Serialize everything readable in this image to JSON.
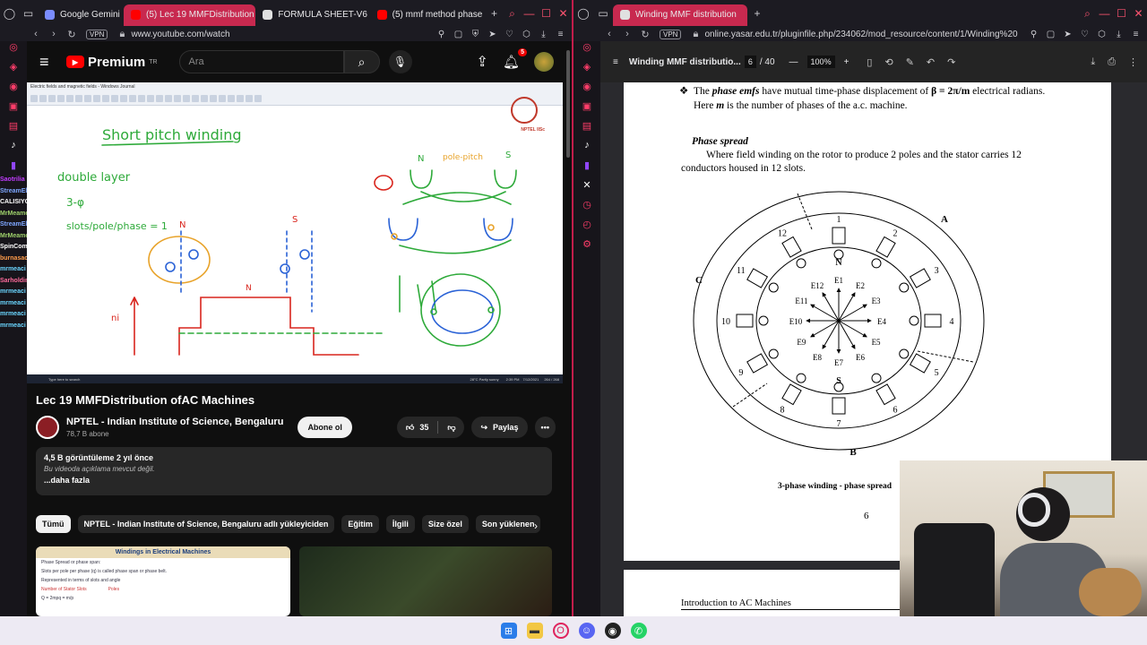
{
  "left_browser": {
    "tabs": [
      {
        "label": "Google Gemini"
      },
      {
        "label": "(5) Lec 19 MMFDistribution"
      },
      {
        "label": "FORMULA SHEET-V6"
      },
      {
        "label": "(5) mmf method phase"
      }
    ],
    "vpn": "VPN",
    "url": "www.youtube.com/watch"
  },
  "youtube": {
    "logo": "Premium",
    "logo_region": "TR",
    "search_placeholder": "Ara",
    "notif_count": "5",
    "video": {
      "title": "Lec 19 MMFDistribution ofAC Machines",
      "channel": "NPTEL - Indian Institute of Science, Bengaluru",
      "subscribers": "78,7 B abone",
      "subscribe_label": "Abone ol",
      "likes": "35",
      "share_label": "Paylaş",
      "stats": "4,5 B görüntüleme  2 yıl önce",
      "description": "Bu videoda açıklama mevcut değil.",
      "more": "...daha fazla"
    },
    "whiteboard": {
      "app_title": "Electric fields and magnetic fields - Windows Journal",
      "heading": "Short pitch winding",
      "line1": "double layer",
      "line2": "3-φ",
      "line3": "slots/pole/phase = 1",
      "labels": {
        "N": "N",
        "S": "S",
        "pole_pitch": "pole-pitch",
        "ni": "ni",
        "nptel": "NPTEL IISc"
      },
      "taskbar_search": "Type here to search",
      "weather": "28°C  Partly sunny",
      "time": "2:39 PM",
      "date": "7/12/2021",
      "page": "264 / 268"
    },
    "chat": [
      {
        "name": "Saotrilia",
        "msg": "■■■■■■■■"
      },
      {
        "name": "StreamElements",
        "msg": "■■■■■■■■■■■■"
      },
      {
        "name": "CALISIYORUM",
        "msg": ""
      },
      {
        "name": "MrMeamen",
        "msg": "■■■■■■■■"
      },
      {
        "name": "StreamElements",
        "msg": "■■■■■■■■■■■■"
      },
      {
        "name": "MrMeamen",
        "msg": "■■■■■■"
      },
      {
        "name": "SpinCom",
        "msg": "■■■"
      },
      {
        "name": "burnasachardefbadg",
        "msg": "■■■■■■■■"
      },
      {
        "name": "mrmeaci",
        "msg": "■■■■■■■■■■"
      },
      {
        "name": "Sarholdim",
        "msg": "■■■■■■■"
      },
      {
        "name": "mrmeaci",
        "msg": "■■■■■■■■■■"
      },
      {
        "name": "mrmeaci",
        "msg": "■■■■■■"
      },
      {
        "name": "mrmeaci",
        "msg": "■■■■■■■■"
      },
      {
        "name": "mrmeaci",
        "msg": "■■■■■■■■■■"
      }
    ],
    "chips": [
      "Tümü",
      "NPTEL - Indian Institute of Science, Bengaluru adlı yükleyiciden",
      "Eğitim",
      "İlgili",
      "Size özel",
      "Son yüklenen"
    ],
    "thumb1_title": "Windings in Electrical Machines",
    "thumb1_text": "Phase Spread or phase span:",
    "thumb1_b1": "Slots per pole per phase (q) is called phase span or phase belt.",
    "thumb1_b2": "Represented in terms of slots and angle",
    "thumb1_formula": "Q = 2mpq = m/p",
    "thumb1_label1": "Number of Stator Slots",
    "thumb1_label2": "Poles"
  },
  "right_browser": {
    "tab": "Winding MMF distribution",
    "vpn": "VPN",
    "url": "online.yasar.edu.tr/pluginfile.php/234062/mod_resource/content/1/Winding%20",
    "pdf": {
      "title": "Winding MMF distributio...",
      "page": "6",
      "pages": "/ 40",
      "zoom": "100%"
    }
  },
  "document": {
    "bullet_pre": "The ",
    "bullet_em": "phase emfs",
    "bullet_mid": " have mutual time-phase displacement of ",
    "beta": "β = 2π/m",
    "bullet_post": " electrical radians. Here ",
    "m": "m",
    "bullet_end": " is the number of phases of the a.c. machine.",
    "phase_spread_heading": "Phase spread",
    "phase_spread_body": "Where field winding on the rotor to produce 2 poles and the stator carries 12 conductors housed in 12 slots.",
    "figure": {
      "slots": [
        "1",
        "2",
        "3",
        "4",
        "5",
        "6",
        "7",
        "8",
        "9",
        "10",
        "11",
        "12"
      ],
      "emfs": [
        "E1",
        "E2",
        "E3",
        "E4",
        "E5",
        "E6",
        "E7",
        "E8",
        "E9",
        "E10",
        "E11",
        "E12"
      ],
      "phases": [
        "A",
        "B",
        "C"
      ],
      "poles": [
        "N",
        "S"
      ]
    },
    "caption": "3-phase winding - phase spread",
    "page_number": "6",
    "next_heading": "Introduction to AC Machines"
  },
  "colors": {
    "accent": "#c8294f",
    "yt_red": "#ff0000",
    "ink_green": "#2eaa3a",
    "ink_blue": "#2a62d6",
    "ink_red": "#d9251d"
  }
}
